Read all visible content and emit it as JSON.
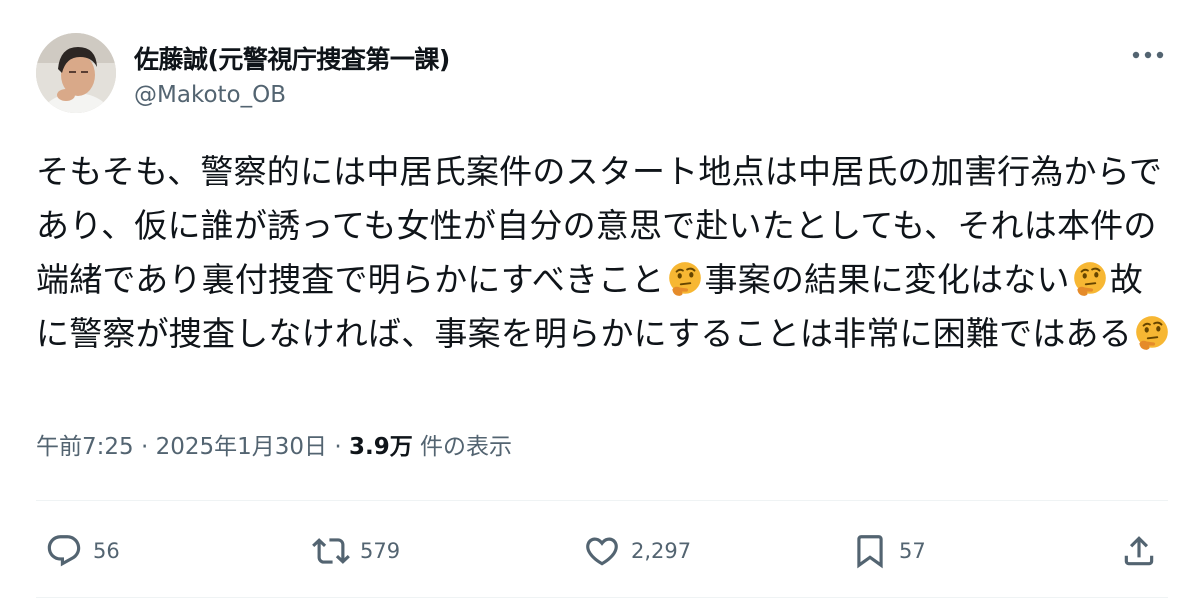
{
  "author": {
    "display_name": "佐藤誠(元警視庁捜査第一課)",
    "handle": "@Makoto_OB",
    "avatar_icon": "avatar-photo"
  },
  "menu_icon": "more-horizontal-icon",
  "post": {
    "segments": [
      "そもそも、警察的には中居氏案件のスタート地点は中居氏の加害行為からであり、仮に誰が誘っても女性が自分の意思で赴いたとしても、それは本件の端緒であり裏付捜査で明らかにすべきこと",
      "事案の結果に変化はない",
      "故に警察が捜査しなければ、事案を明らかにすることは非常に困難ではある"
    ],
    "emoji": "thinking-face-emoji"
  },
  "meta": {
    "time": "午前7:25",
    "separator": " · ",
    "date": "2025年1月30日",
    "views_count": "3.9万",
    "views_label": " 件の表示"
  },
  "actions": {
    "reply": {
      "icon": "reply-icon",
      "count": "56"
    },
    "repost": {
      "icon": "repost-icon",
      "count": "579"
    },
    "like": {
      "icon": "heart-icon",
      "count": "2,297"
    },
    "bookmark": {
      "icon": "bookmark-icon",
      "count": "57"
    },
    "share": {
      "icon": "share-icon"
    }
  },
  "colors": {
    "text_primary": "#0f1419",
    "text_secondary": "#536471",
    "divider": "#eff3f4",
    "emoji_face": "#f7b733"
  }
}
